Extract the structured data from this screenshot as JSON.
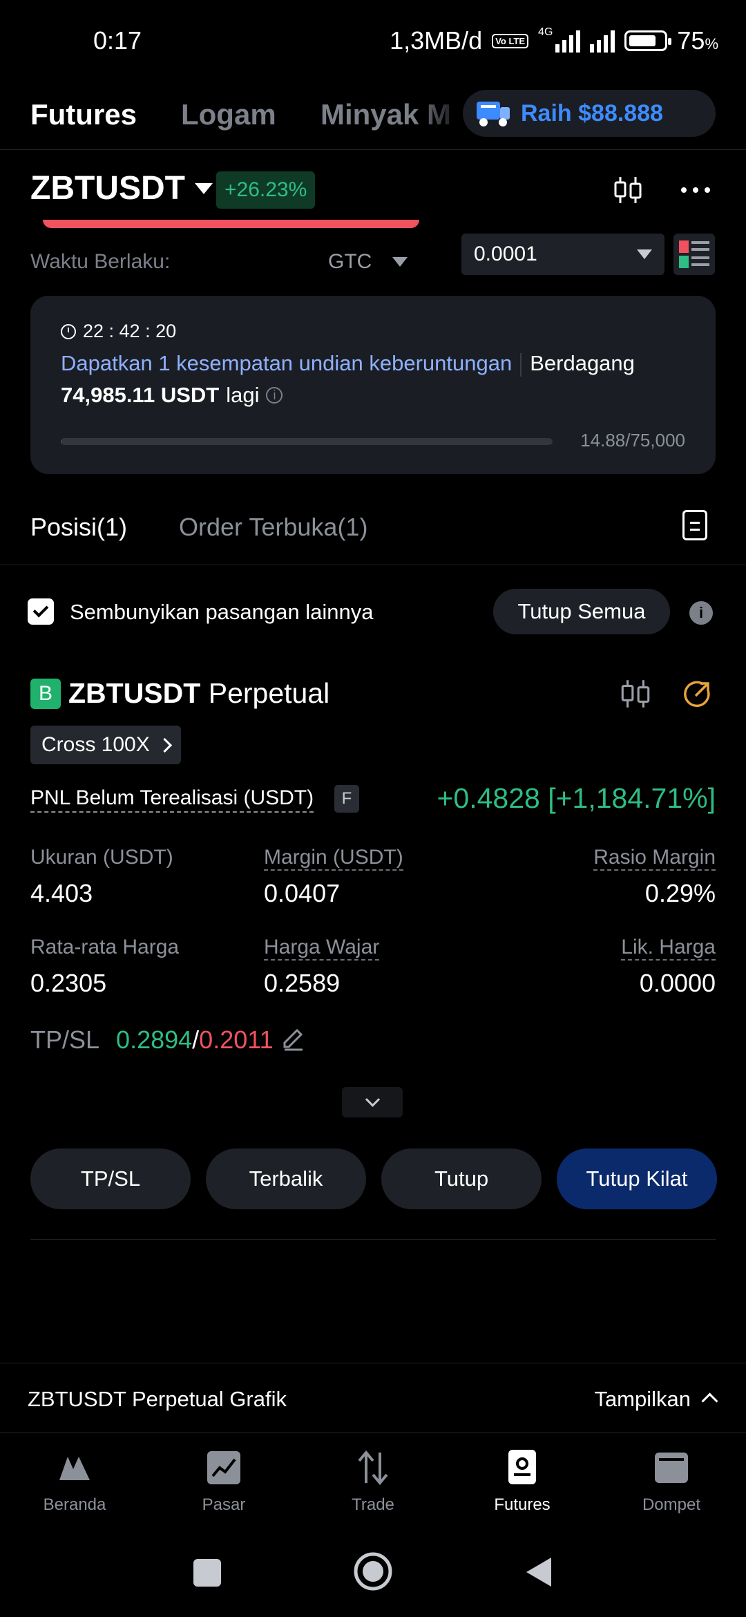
{
  "status": {
    "time": "0:17",
    "speed": "1,3MB/d",
    "net_lte": "Vo LTE",
    "net_4g": "4G",
    "battery": "75",
    "battery_unit": "%"
  },
  "top_tabs": [
    "Futures",
    "Logam",
    "Minyak M"
  ],
  "promo_pill": {
    "label": "Raih $88.888"
  },
  "pair": {
    "symbol": "ZBTUSDT",
    "change": "+26.23%"
  },
  "order": {
    "waktu_label": "Waktu Berlaku:",
    "tif": "GTC",
    "precision": "0.0001"
  },
  "promo_card": {
    "timer": "22 : 42 : 20",
    "link_text": "Dapatkan 1 kesempatan undian keberuntungan",
    "text_a": "Berdagang",
    "amount": "74,985.11 USDT",
    "text_b": "lagi",
    "progress_text": "14.88/75,000",
    "progress_fraction": 0.000198
  },
  "position_tabs": {
    "positions": "Posisi(1)",
    "open_orders": "Order Terbuka(1)"
  },
  "hide_row": {
    "label": "Sembunyikan pasangan lainnya",
    "close_all": "Tutup Semua"
  },
  "position": {
    "side_badge": "B",
    "symbol": "ZBTUSDT",
    "type": "Perpetual",
    "leverage": "Cross 100X",
    "pnl_label": "PNL Belum Terealisasi (USDT)",
    "pnl_badge": "F",
    "pnl_value": "+0.4828 [+1,184.71%]",
    "stats": {
      "size_label": "Ukuran (USDT)",
      "size": "4.403",
      "margin_label": "Margin (USDT)",
      "margin": "0.0407",
      "ratio_label": "Rasio Margin",
      "ratio": "0.29%",
      "avg_label": "Rata-rata Harga",
      "avg": "0.2305",
      "fair_label": "Harga Wajar",
      "fair": "0.2589",
      "liq_label": "Lik. Harga",
      "liq": "0.0000"
    },
    "tpsl_label": "TP/SL",
    "tp": "0.2894",
    "slash": "/",
    "sl": "0.2011"
  },
  "actions": [
    "TP/SL",
    "Terbalik",
    "Tutup",
    "Tutup Kilat"
  ],
  "chart_bar": {
    "label": "ZBTUSDT Perpetual Grafik",
    "action": "Tampilkan"
  },
  "nav": [
    {
      "label": "Beranda",
      "icon": "home-icon"
    },
    {
      "label": "Pasar",
      "icon": "market-chart-icon"
    },
    {
      "label": "Trade",
      "icon": "trade-arrows-icon"
    },
    {
      "label": "Futures",
      "icon": "futures-doc-icon"
    },
    {
      "label": "Dompet",
      "icon": "wallet-icon"
    }
  ],
  "colors": {
    "bg": "#000000",
    "card": "#1a1d23",
    "green": "#2ebd85",
    "red": "#f0525f",
    "blue": "#3d8bff",
    "primary_btn": "#0a2a6c"
  }
}
